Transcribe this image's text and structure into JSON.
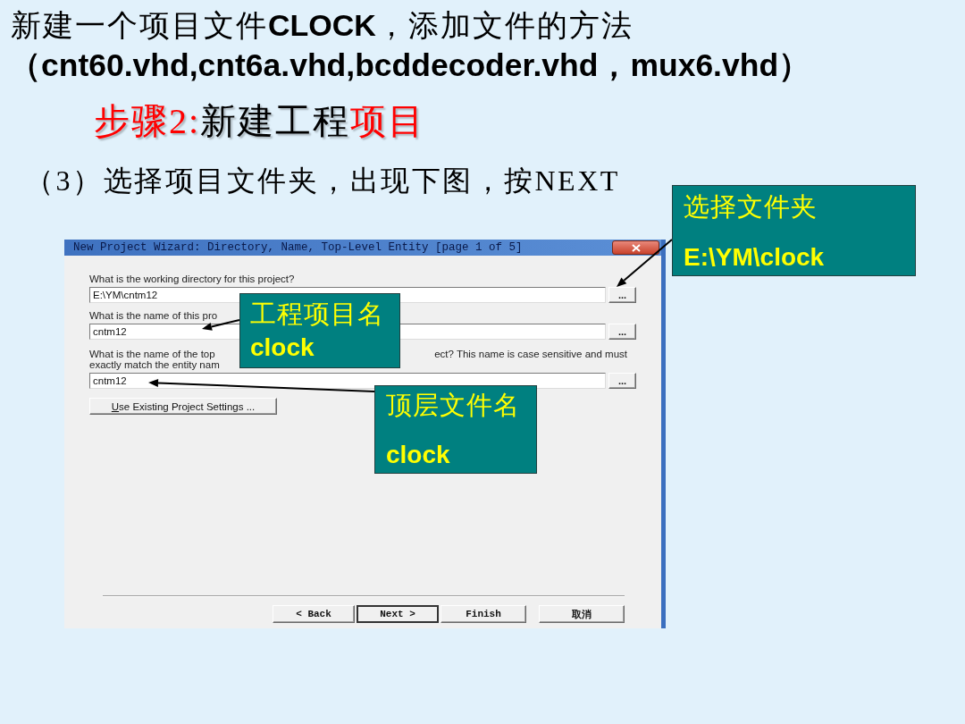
{
  "intro": {
    "title": "新建一个项目文件**CLOCK**，添加文件的方法",
    "file_list": "（cnt60.vhd,cnt6a.vhd,bcddecoder.vhd，mux6.vhd）"
  },
  "step_heading": [
    {
      "text": "步骤2:",
      "color": "#ff0000"
    },
    {
      "text": "新建工程",
      "color": "#000000"
    },
    {
      "text": "项目",
      "color": "#ff0000"
    }
  ],
  "instruction": "（3）选择项目文件夹，出现下图，按NEXT",
  "dialog": {
    "title": "New Project Wizard: Directory, Name, Top-Level Entity [page 1 of 5]",
    "fields": [
      {
        "label_lines": [
          [
            "What is the working directory for this project?"
          ]
        ],
        "value": "E:\\YM\\cntm12",
        "browse_label": "..."
      },
      {
        "label_lines": [
          [
            "What is the name of this pro"
          ]
        ],
        "value": "cntm12",
        "browse_label": "..."
      },
      {
        "label_lines": [
          [
            "What is the name of the top",
            "ect? This name is case sensitive and must"
          ],
          [
            "exactly match the entity nam"
          ]
        ],
        "value": "cntm12",
        "browse_label": "..."
      }
    ],
    "settings_button": "Use Existing Project Settings ...",
    "buttons": [
      {
        "label": "< Back",
        "focused": false
      },
      {
        "label": "Next >",
        "focused": true
      },
      {
        "label": "Finish",
        "focused": false
      },
      {
        "label": "取消",
        "focused": false
      }
    ]
  },
  "callouts": [
    {
      "title": "选择文件夹",
      "value": "E:\\YM\\clock"
    },
    {
      "title": "工程项目名",
      "value": "clock"
    },
    {
      "title": "顶层文件名",
      "value": "clock"
    }
  ]
}
